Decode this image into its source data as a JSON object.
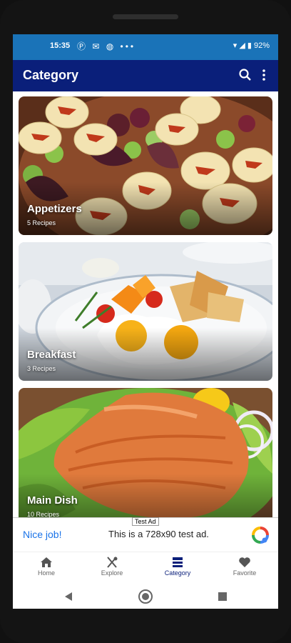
{
  "status": {
    "time": "15:35",
    "battery": "92%"
  },
  "appbar": {
    "title": "Category"
  },
  "categories": [
    {
      "name": "Appetizers",
      "count": "5 Recipes"
    },
    {
      "name": "Breakfast",
      "count": "3 Recipes"
    },
    {
      "name": "Main Dish",
      "count": "10 Recipes"
    }
  ],
  "ad": {
    "tag": "Test Ad",
    "cta": "Nice job!",
    "message": "This is a 728x90 test ad."
  },
  "nav": [
    {
      "label": "Home",
      "icon": "home-icon"
    },
    {
      "label": "Explore",
      "icon": "utensils-icon"
    },
    {
      "label": "Category",
      "icon": "list-icon"
    },
    {
      "label": "Favorite",
      "icon": "heart-icon"
    }
  ],
  "colors": {
    "statusbar": "#1a73b8",
    "appbar": "#0a1f7a",
    "ad_cta": "#1a73e8"
  }
}
